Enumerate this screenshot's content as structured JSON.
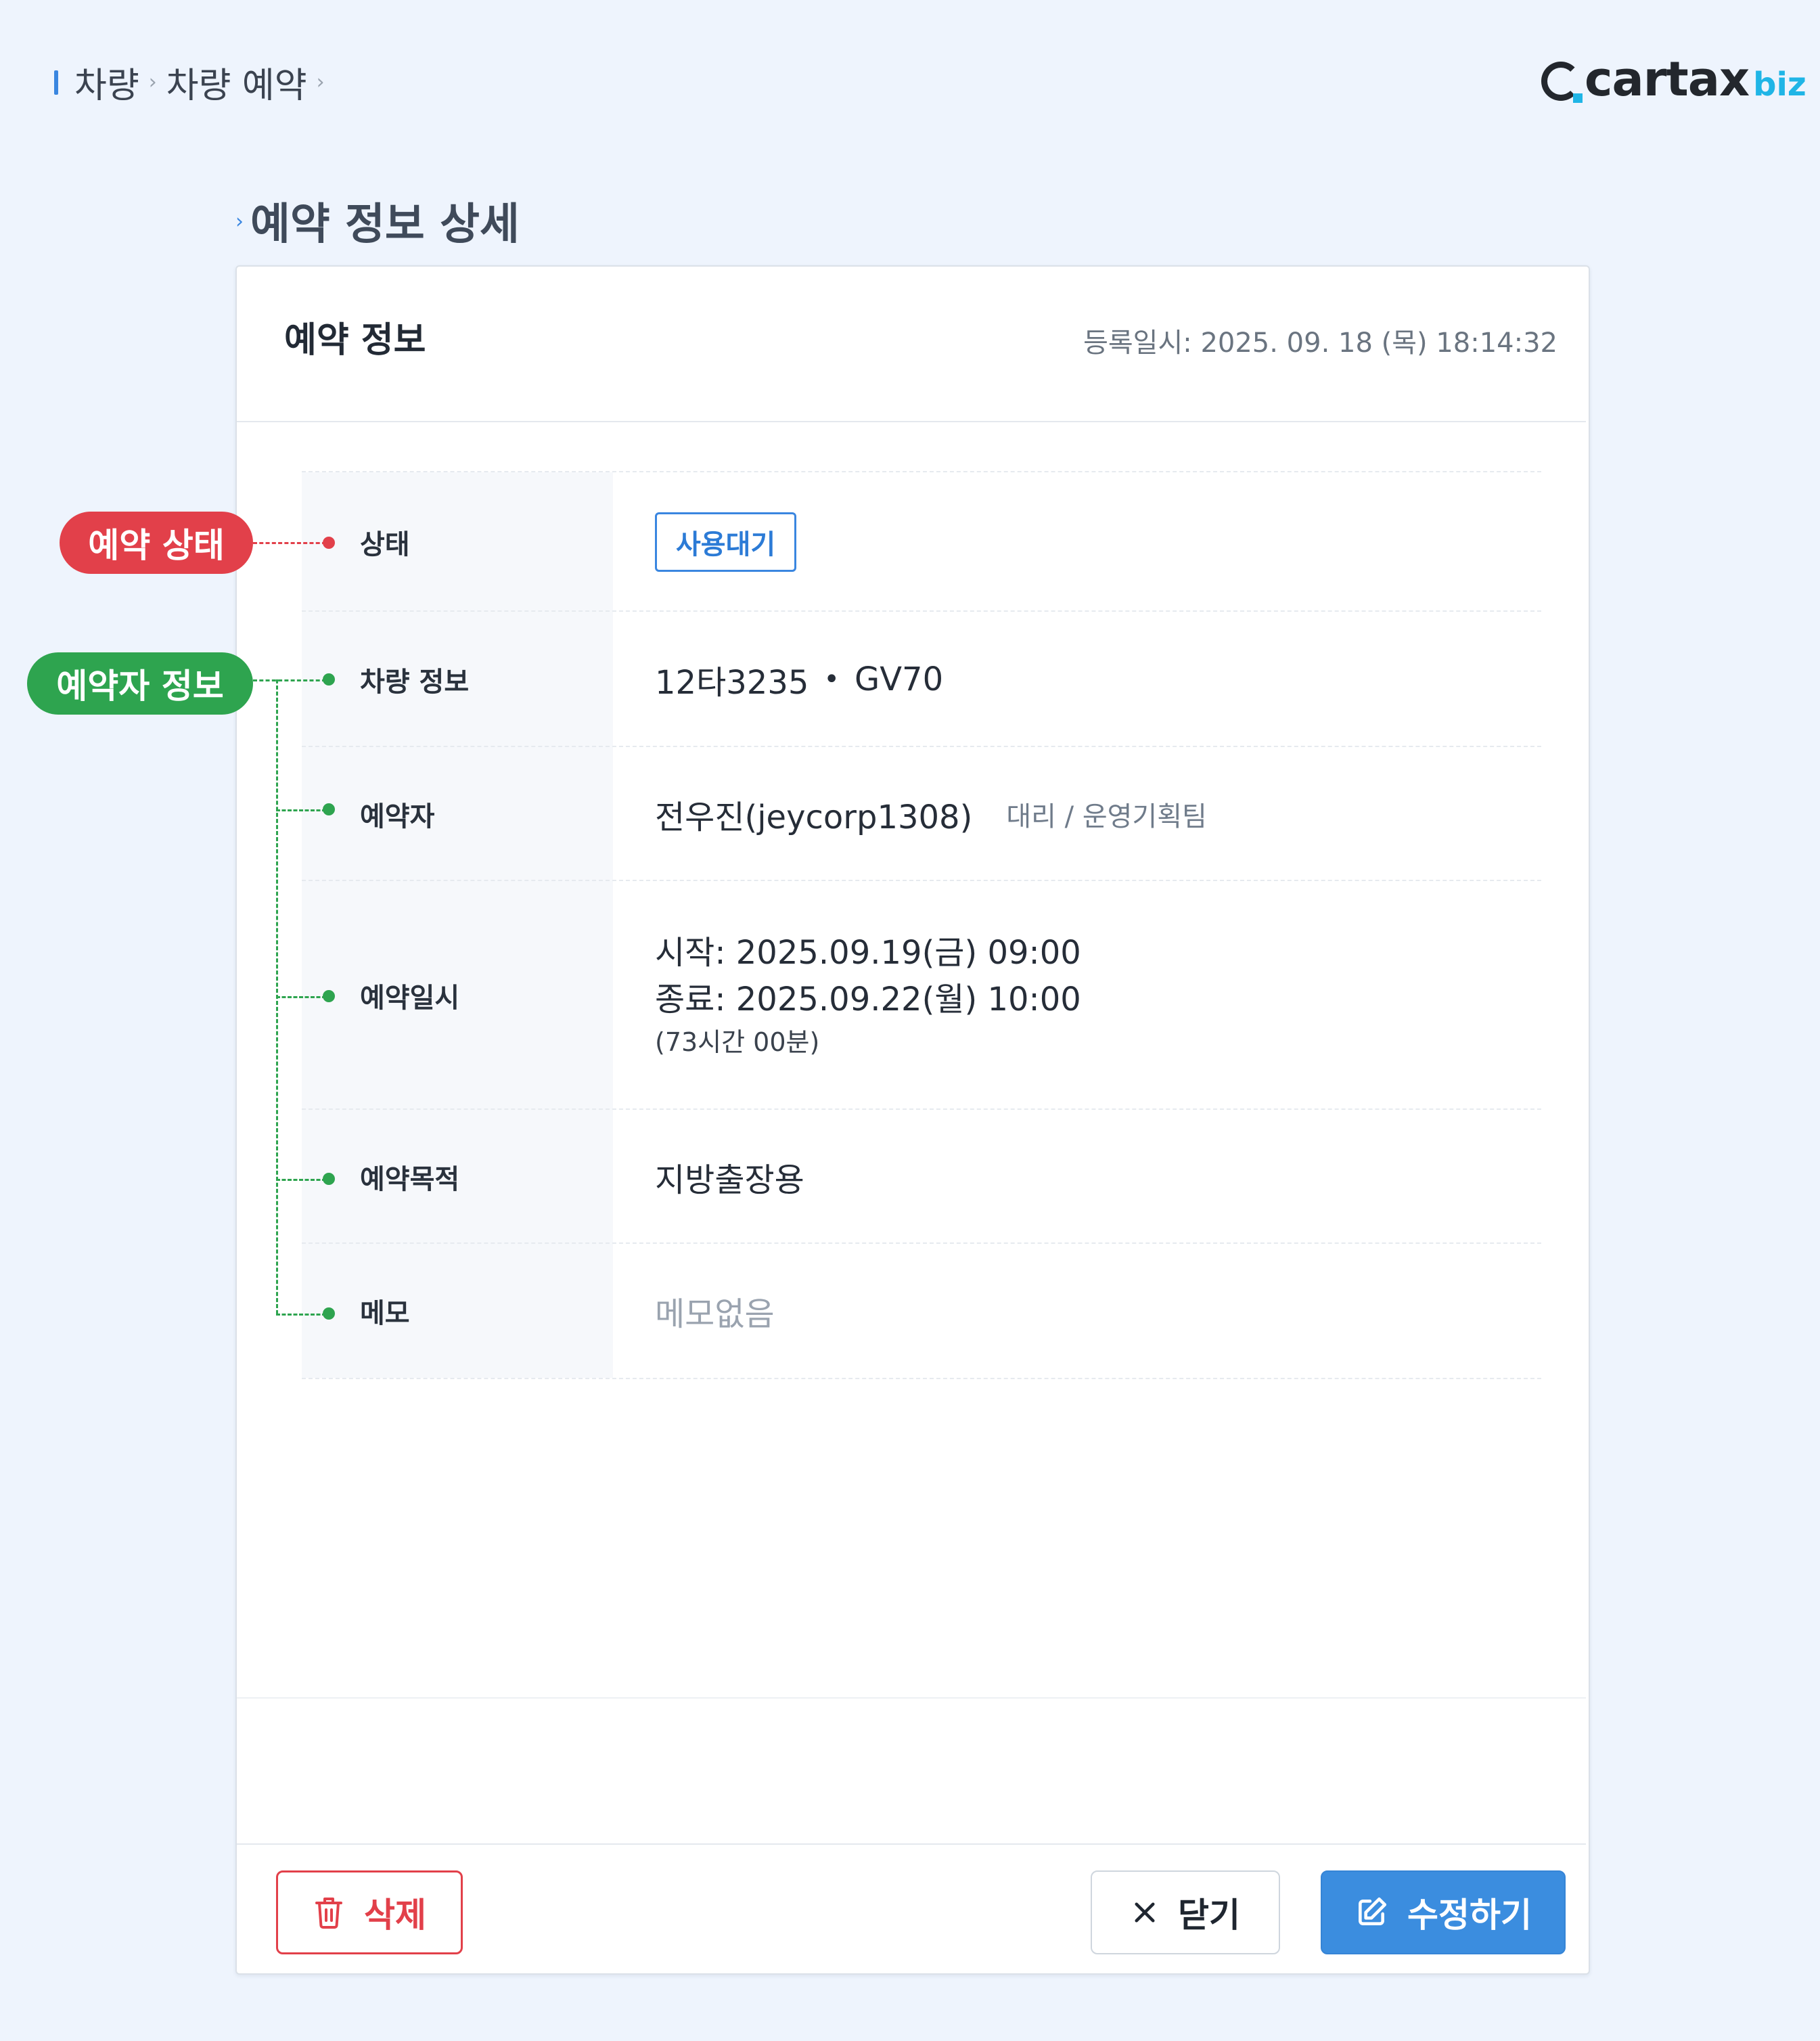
{
  "breadcrumb": {
    "items": [
      "차량",
      "차량 예약"
    ],
    "separator": "›"
  },
  "logo": {
    "name": "cartax",
    "suffix": "biz"
  },
  "section_title": "예약 정보 상세",
  "card": {
    "title": "예약 정보",
    "registered_label": "등록일시: 2025. 09. 18 (목) 18:14:32"
  },
  "rows": {
    "status": {
      "label": "상태",
      "badge": "사용대기"
    },
    "vehicle": {
      "label": "차량 정보",
      "plate": "12타3235",
      "separator": "•",
      "model": "GV70"
    },
    "reserver": {
      "label": "예약자",
      "name": "전우진(jeycorp1308)",
      "detail": "대리 / 운영기획팀"
    },
    "datetime": {
      "label": "예약일시",
      "start": "시작: 2025.09.19(금) 09:00",
      "end": "종료: 2025.09.22(월) 10:00",
      "duration": "(73시간 00분)"
    },
    "purpose": {
      "label": "예약목적",
      "value": "지방출장용"
    },
    "memo": {
      "label": "메모",
      "value": "메모없음"
    }
  },
  "annotations": {
    "status": "예약 상태",
    "reserver_info": "예약자 정보"
  },
  "buttons": {
    "delete": "삭제",
    "close": "닫기",
    "edit": "수정하기"
  },
  "colors": {
    "accent": "#3b8ddf",
    "danger": "#e2404a",
    "annotation_green": "#2ea44f",
    "background": "#eef4fd"
  },
  "icons": [
    "trash-icon",
    "close-icon",
    "edit-icon",
    "cartax-logo-icon"
  ]
}
